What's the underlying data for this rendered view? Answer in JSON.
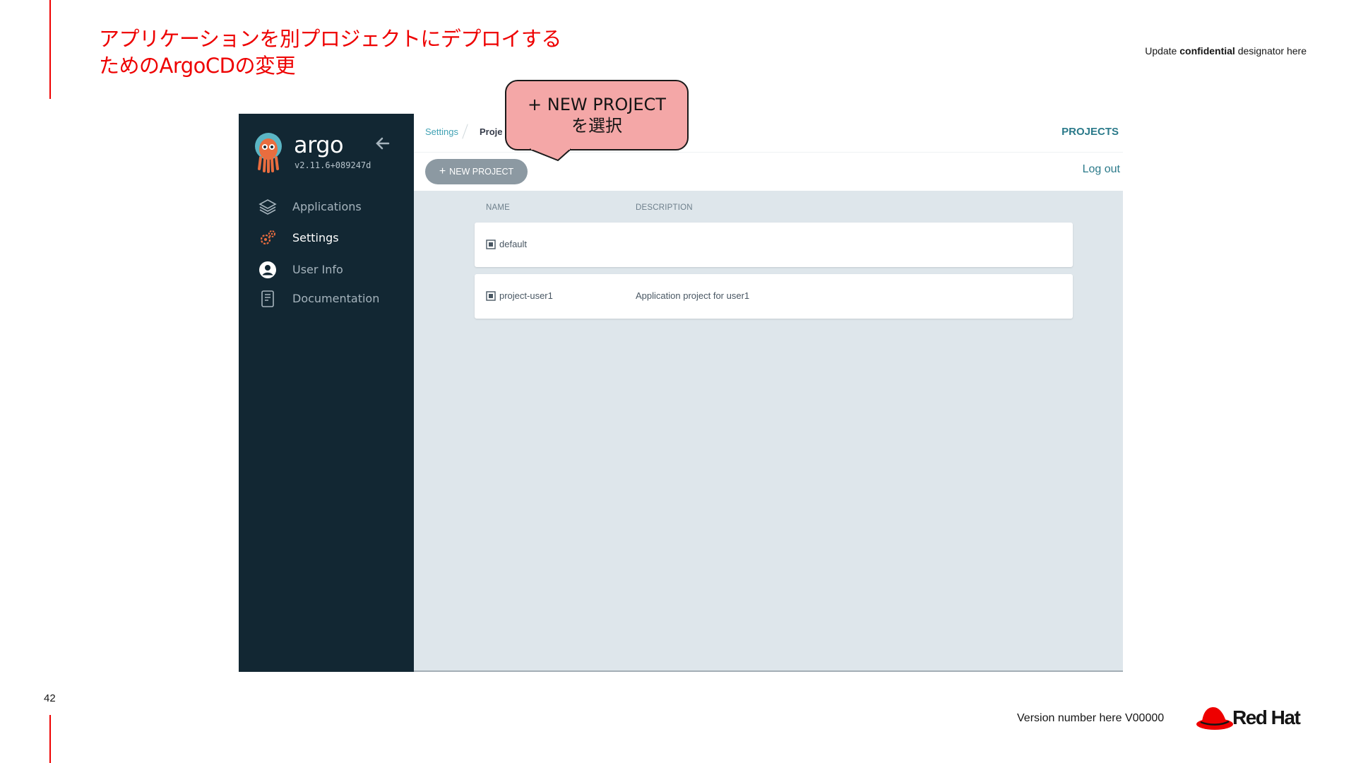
{
  "slide": {
    "title_line1": "アプリケーションを別プロジェクトにデプロイする",
    "title_line2": "ためのArgoCDの変更",
    "confidential_prefix": "Update ",
    "confidential_bold": "confidential",
    "confidential_suffix": " designator here",
    "page_number": "42",
    "version": "Version number here V00000",
    "logo_text": "Red Hat",
    "accent_color": "#ee0000"
  },
  "callout": {
    "line1": "+ NEW PROJECT",
    "line2": "を選択",
    "fill_color": "#f4a7a7"
  },
  "argo": {
    "brand": "argo",
    "version": "v2.11.6+089247d",
    "nav": [
      {
        "label": "Applications",
        "icon": "layers-icon",
        "active": false
      },
      {
        "label": "Settings",
        "icon": "gears-icon",
        "active": true
      },
      {
        "label": "User Info",
        "icon": "user-circle-icon",
        "active": false
      },
      {
        "label": "Documentation",
        "icon": "book-icon",
        "active": false
      }
    ],
    "breadcrumb": {
      "parent": "Settings",
      "current": "Proje"
    },
    "page_title": "PROJECTS",
    "new_project_label": "NEW PROJECT",
    "logout_label": "Log out",
    "columns": {
      "name": "NAME",
      "description": "DESCRIPTION"
    },
    "projects": [
      {
        "name": "default",
        "description": ""
      },
      {
        "name": "project-user1",
        "description": "Application project for user1"
      }
    ],
    "sidebar_color": "#122733",
    "content_bg_color": "#dee6eb",
    "link_color": "#2b7a8a"
  }
}
